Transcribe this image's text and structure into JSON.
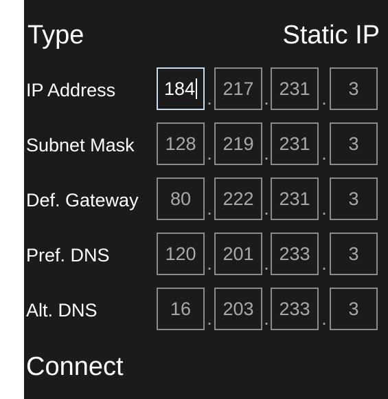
{
  "type": {
    "label": "Type",
    "value": "Static IP"
  },
  "fields": [
    {
      "label": "IP Address",
      "octets": [
        "184",
        "217",
        "231",
        "3"
      ]
    },
    {
      "label": "Subnet Mask",
      "octets": [
        "128",
        "219",
        "231",
        "3"
      ]
    },
    {
      "label": "Def. Gateway",
      "octets": [
        "80",
        "222",
        "231",
        "3"
      ]
    },
    {
      "label": "Pref. DNS",
      "octets": [
        "120",
        "201",
        "233",
        "3"
      ]
    },
    {
      "label": "Alt. DNS",
      "octets": [
        "16",
        "203",
        "233",
        "3"
      ]
    }
  ],
  "separator": ".",
  "connect_label": "Connect",
  "colors": {
    "background": "#1b1b1b",
    "text": "#ffffff",
    "field_text": "#a9a9a9",
    "field_border": "#8a8a8a",
    "focus_border": "#c8dcf0"
  }
}
